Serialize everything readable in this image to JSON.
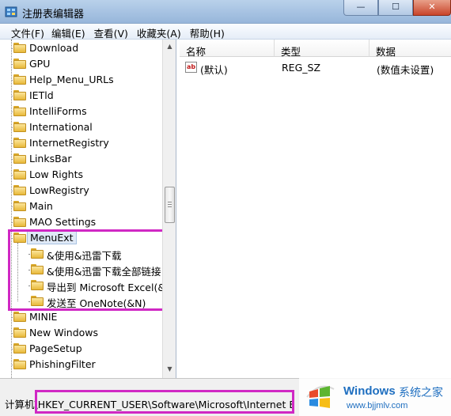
{
  "window": {
    "title": "注册表编辑器",
    "min_label": "—",
    "max_label": "☐",
    "close_label": "✕"
  },
  "menu": {
    "items": [
      {
        "label": "文件(F)"
      },
      {
        "label": "编辑(E)"
      },
      {
        "label": "查看(V)"
      },
      {
        "label": "收藏夹(A)"
      },
      {
        "label": "帮助(H)"
      }
    ]
  },
  "tree": {
    "items": [
      {
        "label": "Download",
        "level": 0
      },
      {
        "label": "GPU",
        "level": 0
      },
      {
        "label": "Help_Menu_URLs",
        "level": 0
      },
      {
        "label": "IETld",
        "level": 0
      },
      {
        "label": "IntelliForms",
        "level": 0
      },
      {
        "label": "International",
        "level": 0
      },
      {
        "label": "InternetRegistry",
        "level": 0
      },
      {
        "label": "LinksBar",
        "level": 0
      },
      {
        "label": "Low Rights",
        "level": 0
      },
      {
        "label": "LowRegistry",
        "level": 0
      },
      {
        "label": "Main",
        "level": 0
      },
      {
        "label": "MAO Settings",
        "level": 0
      },
      {
        "label": "MenuExt",
        "level": 0,
        "selected": true
      },
      {
        "label": "&使用&迅雷下载",
        "level": 1
      },
      {
        "label": "&使用&迅雷下载全部链接",
        "level": 1
      },
      {
        "label": "导出到 Microsoft Excel(&X)",
        "level": 1
      },
      {
        "label": "发送至 OneNote(&N)",
        "level": 1
      },
      {
        "label": "MINIE",
        "level": 0
      },
      {
        "label": "New Windows",
        "level": 0
      },
      {
        "label": "PageSetup",
        "level": 0
      },
      {
        "label": "PhishingFilter",
        "level": 0
      }
    ]
  },
  "scrollbar": {
    "up_arrow": "▲",
    "down_arrow": "▼"
  },
  "list": {
    "headers": [
      "名称",
      "类型",
      "数据"
    ],
    "rows": [
      {
        "icon": "ab",
        "name": "(默认)",
        "type": "REG_SZ",
        "data": "(数值未设置)"
      }
    ]
  },
  "status": {
    "path": "计算机\\HKEY_CURRENT_USER\\Software\\Microsoft\\Internet Explorer\\MenuExt"
  },
  "watermark": {
    "brand": "Windows",
    "site": "系统之家",
    "url": "www.bjjmlv.com"
  },
  "colors": {
    "highlight": "#d028c4",
    "folder": "#e8b93a",
    "watermark": "#1f6fc0"
  }
}
